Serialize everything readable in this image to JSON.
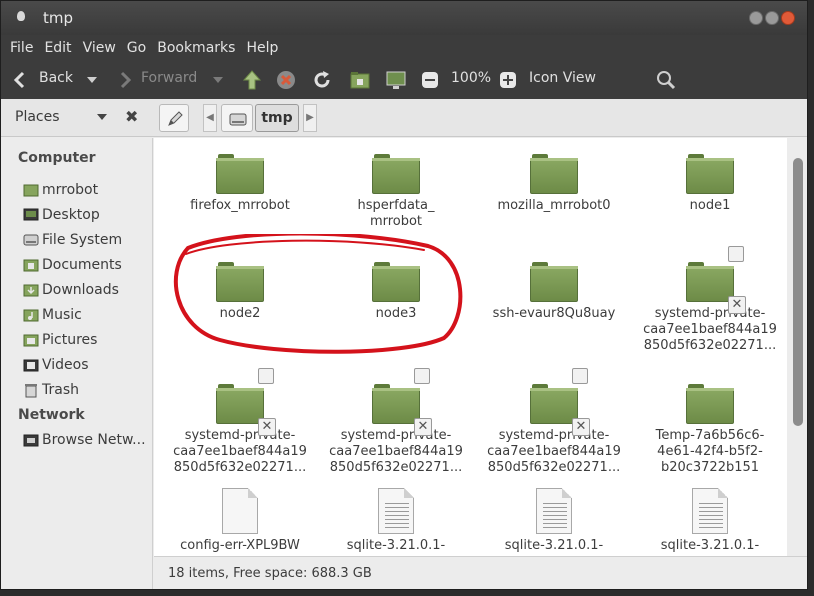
{
  "window": {
    "title": "tmp"
  },
  "menu": [
    "File",
    "Edit",
    "View",
    "Go",
    "Bookmarks",
    "Help"
  ],
  "toolbar": {
    "back": "Back",
    "forward": "Forward",
    "zoom": "100%",
    "view_mode": "Icon View"
  },
  "location": {
    "places_label": "Places",
    "current_folder": "tmp"
  },
  "sidebar": {
    "computer_heading": "Computer",
    "computer_items": [
      "mrrobot",
      "Desktop",
      "File System",
      "Documents",
      "Downloads",
      "Music",
      "Pictures",
      "Videos",
      "Trash"
    ],
    "network_heading": "Network",
    "network_items": [
      "Browse Netw..."
    ]
  },
  "files": [
    {
      "name": "firefox_mrrobot",
      "kind": "folder"
    },
    {
      "name": "hsperfdata_\nmrrobot",
      "kind": "folder"
    },
    {
      "name": "mozilla_mrrobot0",
      "kind": "folder"
    },
    {
      "name": "node1",
      "kind": "folder"
    },
    {
      "name": "node2",
      "kind": "folder"
    },
    {
      "name": "node3",
      "kind": "folder"
    },
    {
      "name": "ssh-evaur8Qu8uay",
      "kind": "folder"
    },
    {
      "name": "systemd-private-\ncaa7ee1baef844a19\n850d5f632e02271...",
      "kind": "locked-folder"
    },
    {
      "name": "systemd-private-\ncaa7ee1baef844a19\n850d5f632e02271...",
      "kind": "locked-folder"
    },
    {
      "name": "systemd-private-\ncaa7ee1baef844a19\n850d5f632e02271...",
      "kind": "locked-folder"
    },
    {
      "name": "systemd-private-\ncaa7ee1baef844a19\n850d5f632e02271...",
      "kind": "locked-folder"
    },
    {
      "name": "Temp-7a6b56c6-\n4e61-42f4-b5f2-\nb20c3722b151",
      "kind": "folder"
    },
    {
      "name": "config-err-XPL9BW",
      "kind": "file"
    },
    {
      "name": "sqlite-3.21.0.1-",
      "kind": "text-file"
    },
    {
      "name": "sqlite-3.21.0.1-",
      "kind": "text-file"
    },
    {
      "name": "sqlite-3.21.0.1-",
      "kind": "text-file"
    }
  ],
  "status": {
    "text": "18 items, Free space: 688.3 GB"
  },
  "colors": {
    "folder": "#7a9852",
    "annotation": "#d4121b",
    "chrome": "#3c3c3c"
  }
}
